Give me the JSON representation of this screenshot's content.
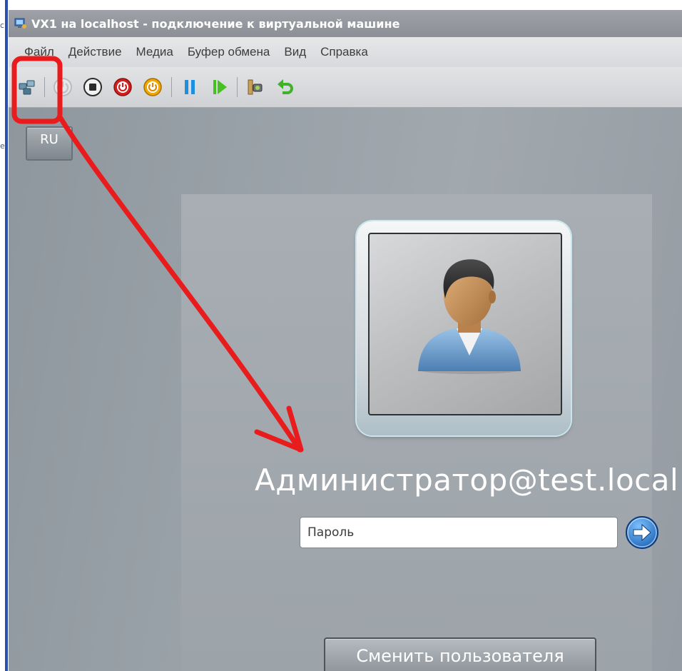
{
  "left_edge": {
    "fragments": [
      "c",
      "e"
    ]
  },
  "window": {
    "title": "VX1 на localhost - подключение к виртуальной машине"
  },
  "menu": {
    "items": [
      "Файл",
      "Действие",
      "Медиа",
      "Буфер обмена",
      "Вид",
      "Справка"
    ]
  },
  "toolbar": {
    "buttons": [
      {
        "name": "ctrl-alt-del-icon",
        "color": "#3f6c86"
      },
      {
        "name": "start-icon",
        "color": "#bfc3c6"
      },
      {
        "name": "turn-off-icon",
        "color": "#2b2b2b"
      },
      {
        "name": "shut-down-icon",
        "color": "#d21f1f"
      },
      {
        "name": "save-state-icon",
        "color": "#e8a500"
      },
      {
        "name": "pause-icon",
        "color": "#1d8fe0"
      },
      {
        "name": "resume-icon",
        "color": "#46c11f"
      },
      {
        "name": "snapshot-icon",
        "color": "#5e9a2b"
      },
      {
        "name": "revert-icon",
        "color": "#3fb22a"
      }
    ]
  },
  "login": {
    "language": "RU",
    "username": "Администратор@test.local",
    "password_placeholder": "Пароль",
    "switch_user_label": "Сменить пользователя"
  },
  "annotation": {
    "color": "#e81c1c"
  }
}
